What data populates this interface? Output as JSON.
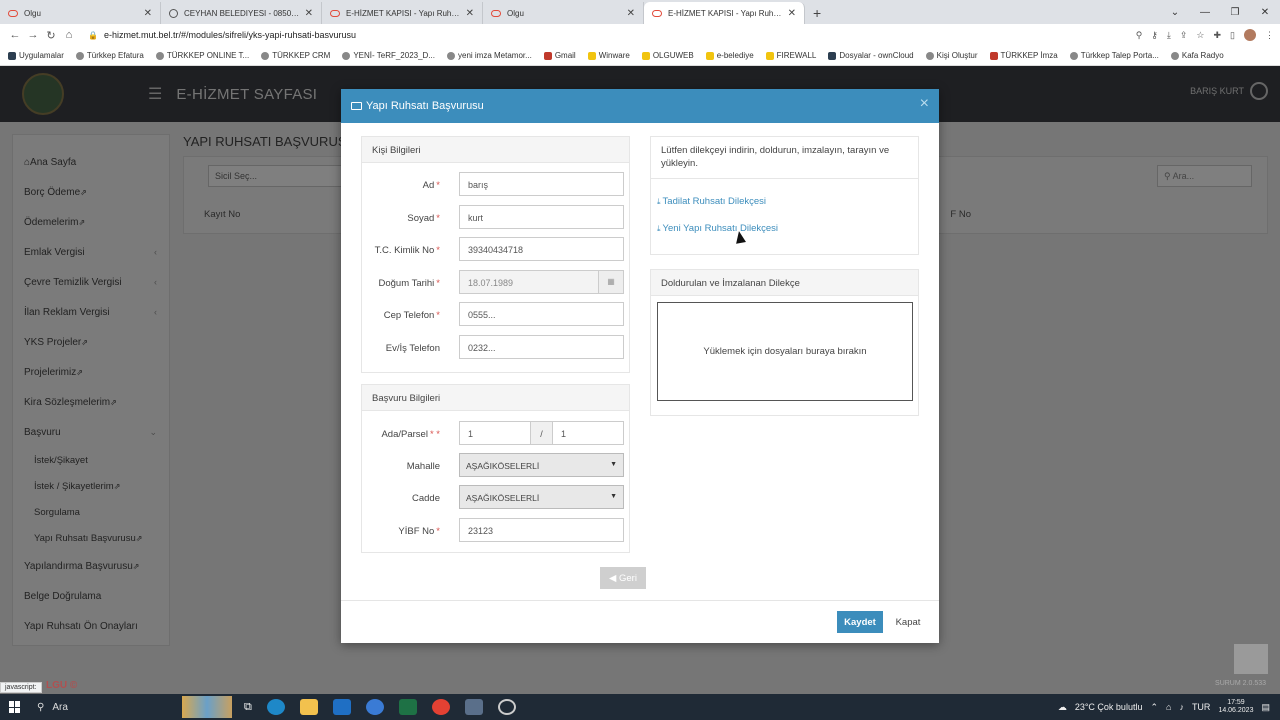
{
  "browser": {
    "tabs": [
      {
        "title": "Olgu",
        "active": false,
        "fav": "red"
      },
      {
        "title": "CEYHAN BELEDIYESI - 0850 30...",
        "active": false,
        "fav": "globe"
      },
      {
        "title": "E-HİZMET KAPISI - Yapı Ruhsatı B...",
        "active": false,
        "fav": "red"
      },
      {
        "title": "Olgu",
        "active": false,
        "fav": "red"
      },
      {
        "title": "E-HİZMET KAPISI - Yapı Ruhsatı B...",
        "active": true,
        "fav": "red"
      }
    ],
    "new_tab": "+",
    "url": "e-hizmet.mut.bel.tr/#/modules/sifreli/yks-yapi-ruhsati-basvurusu",
    "bookmarks": [
      "Uygulamalar",
      "Türkkep Efatura",
      "TÜRKKEP ONLINE T...",
      "TÜRKKEP CRM",
      "YENİ- TeRF_2023_D...",
      "yeni imza Metamor...",
      "Gmail",
      "Winware",
      "OLGUWEB",
      "e-belediye",
      "FIREWALL",
      "Dosyalar - ownCloud",
      "Kişi Oluştur",
      "TÜRKKEP İmza",
      "Türkkep Talep Porta...",
      "Kafa Radyo"
    ]
  },
  "app": {
    "title": "E-HİZMET SAYFASI",
    "user": "BARIŞ KURT",
    "sidebar": [
      {
        "label": "Ana Sayfa",
        "sub": false,
        "ext": false,
        "chev": false
      },
      {
        "label": "Borç Ödeme",
        "sub": false,
        "ext": true,
        "chev": false
      },
      {
        "label": "Ödemelerim",
        "sub": false,
        "ext": true,
        "chev": false
      },
      {
        "label": "Emlak Vergisi",
        "sub": false,
        "ext": false,
        "chev": true
      },
      {
        "label": "Çevre Temizlik Vergisi",
        "sub": false,
        "ext": false,
        "chev": true
      },
      {
        "label": "İlan Reklam Vergisi",
        "sub": false,
        "ext": false,
        "chev": true
      },
      {
        "label": "YKS Projeler",
        "sub": false,
        "ext": true,
        "chev": false
      },
      {
        "label": "Projelerimiz",
        "sub": false,
        "ext": true,
        "chev": false
      },
      {
        "label": "Kira Sözleşmelerim",
        "sub": false,
        "ext": true,
        "chev": false
      },
      {
        "label": "Başvuru",
        "sub": false,
        "ext": false,
        "chev": true
      },
      {
        "label": "İstek/Şikayet",
        "sub": true,
        "ext": false,
        "chev": false
      },
      {
        "label": "İstek / Şikayetlerim",
        "sub": true,
        "ext": true,
        "chev": false
      },
      {
        "label": "Sorgulama",
        "sub": true,
        "ext": false,
        "chev": false
      },
      {
        "label": "Yapı Ruhsatı Başvurusu",
        "sub": true,
        "ext": true,
        "chev": false
      },
      {
        "label": "Yapılandırma Başvurusu",
        "sub": false,
        "ext": true,
        "chev": false
      },
      {
        "label": "Belge Doğrulama",
        "sub": false,
        "ext": false,
        "chev": false
      },
      {
        "label": "Yapı Ruhsatı Ön Onayları",
        "sub": false,
        "ext": false,
        "chev": false
      }
    ],
    "content_title": "YAPI RUHSATI BAŞVURUSU",
    "sicil_placeholder": "Sicil Seç...",
    "search_placeholder": "Ara...",
    "col_kayit": "Kayıt No",
    "col_ytf": "F No",
    "status_js": "javascript:",
    "footer_logo": "LGU ©",
    "version": "SURUM 2.0.533"
  },
  "modal": {
    "title": "Yapı Ruhsatı Başvurusu",
    "close": "×",
    "kisi": {
      "heading": "Kişi Bilgileri",
      "fields": [
        {
          "label": "Ad",
          "value": "barış",
          "type": "text"
        },
        {
          "label": "Soyad",
          "value": "kurt",
          "type": "text"
        },
        {
          "label": "T.C. Kimlik No",
          "value": "39340434718",
          "type": "text"
        },
        {
          "label": "Doğum Tarihi",
          "value": "18.07.1989",
          "type": "date"
        },
        {
          "label": "Cep Telefon",
          "value": "0555...",
          "type": "text"
        },
        {
          "label": "Ev/İş Telefon",
          "value": "0232...",
          "type": "text"
        }
      ]
    },
    "basvuru": {
      "heading": "Başvuru Bilgileri",
      "ada_label": "Ada/Parsel",
      "ada_value": "1",
      "parsel_sep": "/",
      "parsel_value": "1",
      "mahalle_label": "Mahalle",
      "mahalle_value": "AŞAĞIKÖSELERLİ",
      "cadde_label": "Cadde",
      "cadde_value": "AŞAĞIKÖSELERLİ",
      "yibf_label": "YİBF No",
      "yibf_value": "23123"
    },
    "instructions": "Lütfen dilekçeyi indirin, doldurun, imzalayın, tarayın ve yükleyin.",
    "link1": "Tadilat Ruhsatı Dilekçesi",
    "link2": "Yeni Yapı Ruhsatı Dilekçesi",
    "upload_heading": "Doldurulan ve İmzalanan Dilekçe",
    "dropzone_text": "Yüklemek için dosyaları buraya bırakın",
    "geri": "Geri",
    "kaydet": "Kaydet",
    "kapat": "Kapat"
  },
  "taskbar": {
    "search": "Ara",
    "weather": "23°C  Çok bulutlu",
    "lang": "TUR",
    "time": "17:59",
    "date": "14.06.2023"
  }
}
